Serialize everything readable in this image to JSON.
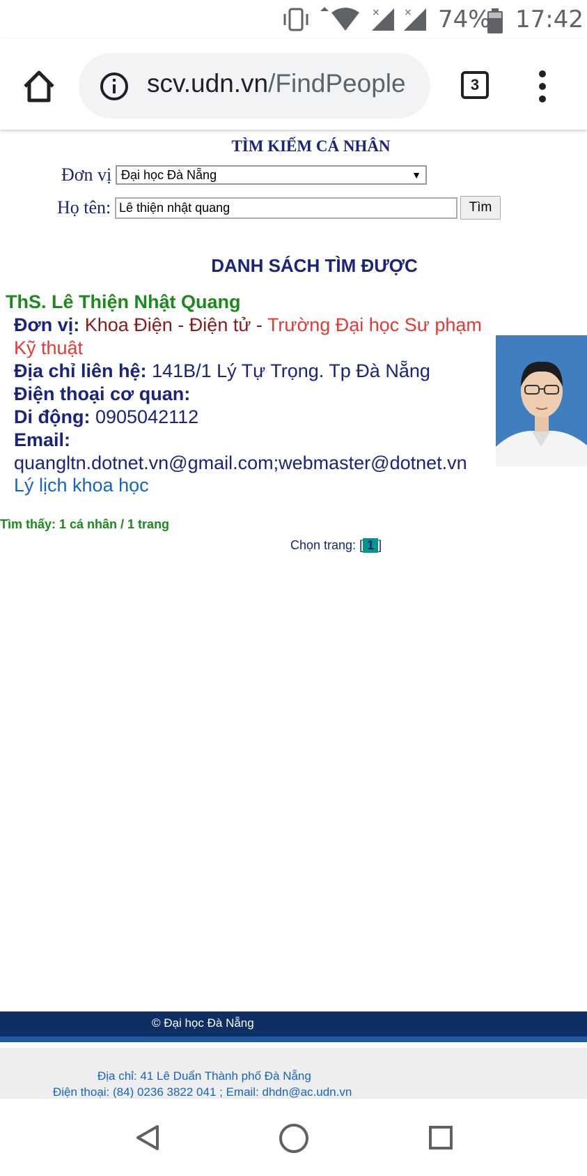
{
  "status_bar": {
    "battery": "74%",
    "time": "17:42"
  },
  "browser": {
    "url_host": "scv.udn.vn",
    "url_path": "/FindPeople",
    "tab_count": "3"
  },
  "search_form": {
    "title": "TÌM KIẾM CÁ NHÂN",
    "unit_label": "Đơn vị",
    "unit_value": "Đại học Đà Nẵng",
    "name_label": "Họ tên:",
    "name_value": "Lê thiện nhật quang",
    "search_button": "Tìm"
  },
  "results": {
    "title": "DANH SÁCH TÌM ĐƯỢC",
    "person": {
      "name": "ThS. Lê Thiện Nhật Quang",
      "unit_label": "Đơn vị:",
      "department": "Khoa Điện - Điện tử",
      "separator": " - ",
      "school_line1": "Trường Đại học Sư phạm",
      "school_line2": "Kỹ thuật",
      "address_label": "Địa chỉ liên hệ:",
      "address": "141B/1 Lý Tự Trọng. Tp Đà Nẵng",
      "office_phone_label": "Điện thoại cơ quan:",
      "mobile_label": "Di động:",
      "mobile": "0905042112",
      "email_label": "Email:",
      "email": "quangltn.dotnet.vn@gmail.com;webmaster@dotnet.vn",
      "cv_link": "Lý lịch khoa học"
    },
    "found_text": "Tìm thấy: 1 cá nhân / 1 trang",
    "pager_label": "Chọn trang: ",
    "pager_open": "[",
    "current_page": "1",
    "pager_close": "]"
  },
  "footer": {
    "copyright": "© Đại học Đà Nẵng",
    "address": "Địa chỉ: 41 Lê Duẩn Thành phố Đà Nẵng",
    "contact": "Điện thoại: (84) 0236 3822 041 ; Email: dhdn@ac.udn.vn"
  }
}
